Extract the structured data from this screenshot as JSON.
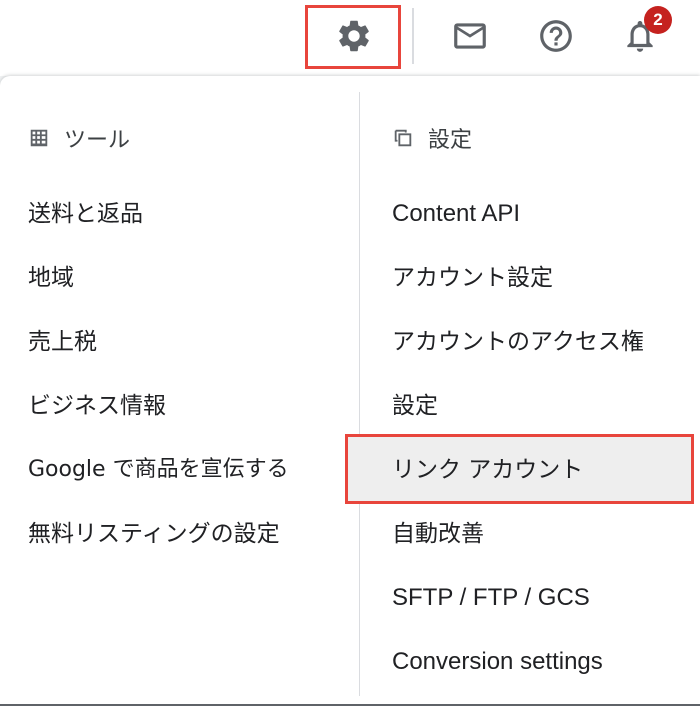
{
  "header": {
    "notification_count": "2",
    "icons": [
      "gear-icon",
      "mail-icon",
      "help-icon",
      "bell-icon"
    ],
    "highlight_color": "#e8453c"
  },
  "tools": {
    "heading": "ツール",
    "icon": "grid-icon",
    "items": [
      "送料と返品",
      "地域",
      "売上税",
      "ビジネス情報",
      "Google で商品を宣伝する",
      "無料リスティングの設定"
    ]
  },
  "settings": {
    "heading": "設定",
    "icon": "copy-icon",
    "items": [
      "Content API",
      "アカウント設定",
      "アカウントのアクセス権",
      "設定",
      "リンク アカウント",
      "自動改善",
      "SFTP / FTP / GCS",
      "Conversion settings"
    ],
    "selected": "リンク アカウント"
  }
}
